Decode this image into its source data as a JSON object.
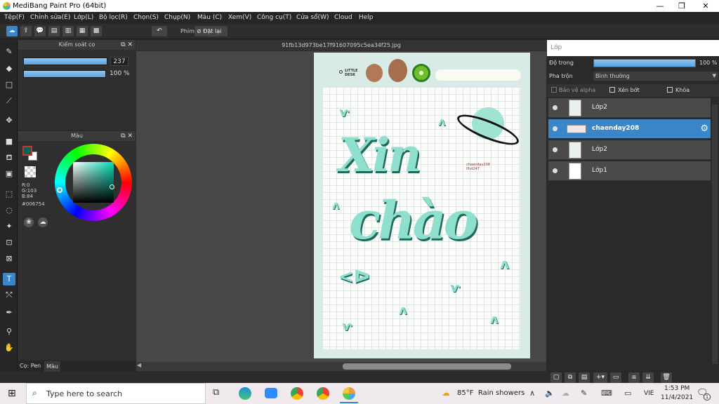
{
  "titlebar": {
    "title": "MediBang Paint Pro (64bit)",
    "minimize": "—",
    "maximize": "❐",
    "close": "✕"
  },
  "menu": [
    "Tệp(F)",
    "Chỉnh sửa(E)",
    "Lớp(L)",
    "Bộ lọc(R)",
    "Chọn(S)",
    "Chụp(N)",
    "Màu (C)",
    "Xem(V)",
    "Công cụ(T)",
    "Cửa sổ(W)",
    "Cloud",
    "Help"
  ],
  "toolbar": {
    "phim_label": "Phím",
    "reset_label": "Đặt lại"
  },
  "brush_panel": {
    "title": "Kiểm soát cọ",
    "size_value": "237",
    "opacity_value": "100 %"
  },
  "color_panel": {
    "title": "Màu",
    "r": "R:0",
    "g": "G:103",
    "b": "B:84",
    "hex": "#006754"
  },
  "bottom_tabs": {
    "pen": "Cọ: Pen",
    "color": "Màu"
  },
  "document": {
    "filename": "91fb13d973be17f91607095c5ea34f25.jpg"
  },
  "artwork": {
    "little_desk": "LITTLE\nDESK",
    "xin": "Xin",
    "chao": "chào",
    "credit": "chaenday208\nlfhd247"
  },
  "layers_panel": {
    "title": "Lớp",
    "opacity_label": "Độ trong",
    "opacity_value": "100 %",
    "opacity_level": 1.0,
    "blend_label": "Pha trộn",
    "blend_value": "Bình thường",
    "protect_alpha": "Bảo vệ alpha",
    "clipping": "Xén bớt",
    "lock": "Khóa",
    "layers": [
      {
        "name": "Lớp2",
        "selected": false
      },
      {
        "name": "chaenday208",
        "selected": true
      },
      {
        "name": "Lớp2",
        "selected": false
      },
      {
        "name": "Lớp1",
        "selected": false
      }
    ]
  },
  "taskbar": {
    "search_placeholder": "Type here to search",
    "weather": "85°F  Rain showers",
    "lang": "VIE",
    "time": "1:53 PM",
    "date": "11/4/2021",
    "notif_count": "1"
  },
  "colors": {
    "accent": "#3a86c8",
    "foreground": "#006754",
    "mint": "#8fdfcf"
  }
}
